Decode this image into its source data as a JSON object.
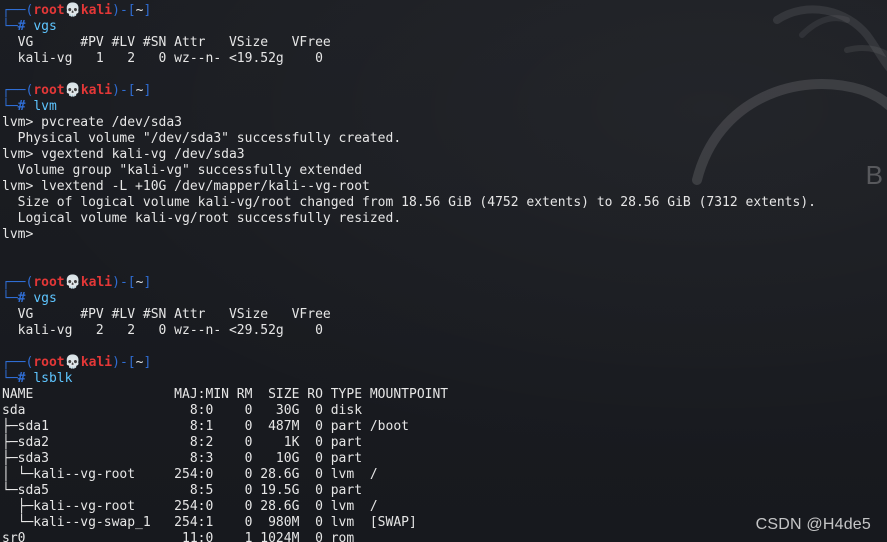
{
  "colors": {
    "background": "#1b1d22",
    "prompt_blue": "#2f6dd3",
    "prompt_red": "#e33737",
    "command_cyan": "#5ec5ff",
    "text": "#e6e6e6"
  },
  "prompt": {
    "top_prefix": "┌──(",
    "user": "root",
    "skull": "💀",
    "host": "kali",
    "mid": ")-[",
    "path": "~",
    "top_suffix": "]",
    "bottom_prefix": "└─",
    "hash": "#"
  },
  "blocks": [
    {
      "command": "vgs",
      "output": [
        "  VG      #PV #LV #SN Attr   VSize   VFree",
        "  kali-vg   1   2   0 wz--n- <19.52g    0"
      ]
    },
    {
      "command": "lvm",
      "output": [
        "lvm> pvcreate /dev/sda3",
        "  Physical volume \"/dev/sda3\" successfully created.",
        "lvm> vgextend kali-vg /dev/sda3",
        "  Volume group \"kali-vg\" successfully extended",
        "lvm> lvextend -L +10G /dev/mapper/kali--vg-root",
        "  Size of logical volume kali-vg/root changed from 18.56 GiB (4752 extents) to 28.56 GiB (7312 extents).",
        "  Logical volume kali-vg/root successfully resized.",
        "lvm>"
      ],
      "extra_blank": true
    },
    {
      "command": "vgs",
      "output": [
        "  VG      #PV #LV #SN Attr   VSize   VFree",
        "  kali-vg   2   2   0 wz--n- <29.52g    0"
      ]
    },
    {
      "command": "lsblk",
      "output": [
        "NAME                  MAJ:MIN RM  SIZE RO TYPE MOUNTPOINT",
        "sda                     8:0    0   30G  0 disk",
        "├─sda1                  8:1    0  487M  0 part /boot",
        "├─sda2                  8:2    0    1K  0 part",
        "├─sda3                  8:3    0   10G  0 part",
        "│ └─kali--vg-root     254:0    0 28.6G  0 lvm  /",
        "└─sda5                  8:5    0 19.5G  0 part",
        "  ├─kali--vg-root     254:0    0 28.6G  0 lvm  /",
        "  └─kali--vg-swap_1   254:1    0  980M  0 lvm  [SWAP]",
        "sr0                    11:0    1 1024M  0 rom"
      ]
    }
  ],
  "background": {
    "logo_letter": "B"
  },
  "watermark": "CSDN @H4de5"
}
